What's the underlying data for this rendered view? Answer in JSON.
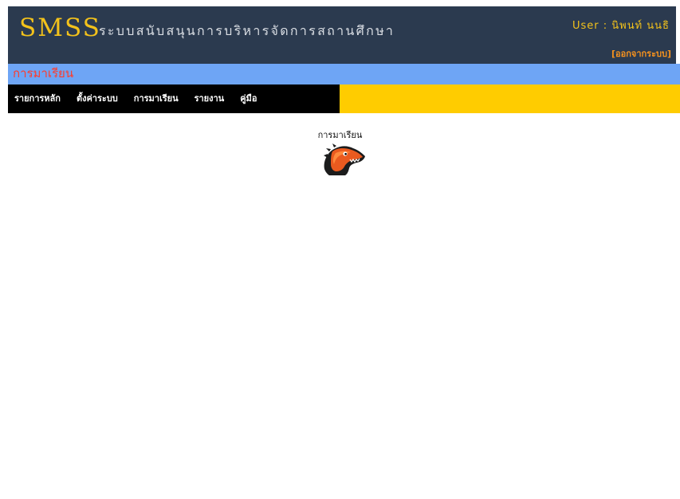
{
  "header": {
    "logo": "SMSS",
    "subtitle": "ระบบสนับสนุนการบริหารจัดการสถานศึกษา",
    "user": "User : นิพนท์ นนธิ",
    "logout_label": "[ออกจากระบบ]"
  },
  "page": {
    "title": "การมาเรียน"
  },
  "menu": {
    "items": [
      {
        "label": "รายการหลัก"
      },
      {
        "label": "ตั้งค่าระบบ"
      },
      {
        "label": "การมาเรียน"
      },
      {
        "label": "รายงาน"
      },
      {
        "label": "คู่มือ"
      }
    ]
  },
  "content": {
    "title": "การมาเรียน",
    "icon": "mozilla-dinosaur-icon"
  },
  "colors": {
    "header_bg": "#2b3a4f",
    "accent_yellow": "#f3c21b",
    "pagebar_bg": "#6ea5f5",
    "pagebar_text": "#ff3b2a",
    "menubar_bg": "#ffcc00",
    "menu_bg": "#000000",
    "logout": "#f7931e"
  }
}
